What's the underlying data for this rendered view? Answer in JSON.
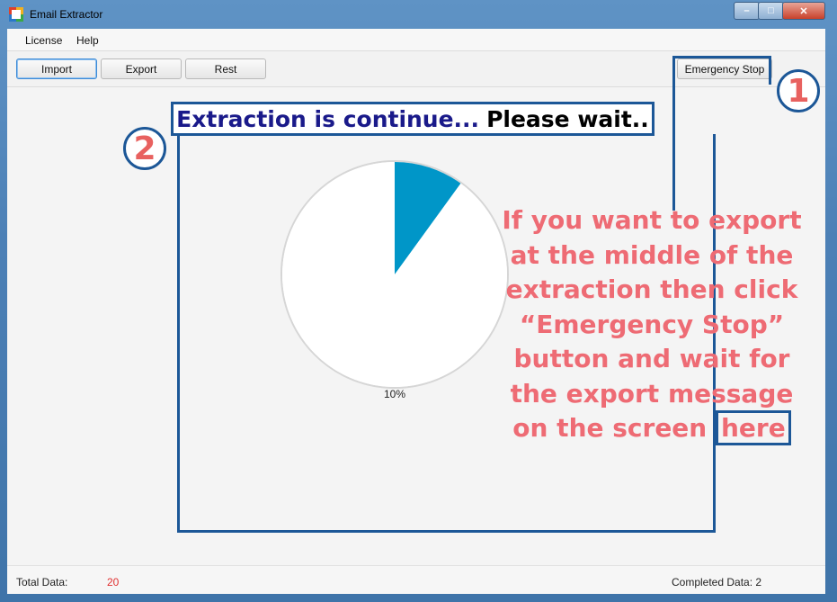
{
  "window": {
    "title": "Email Extractor",
    "minimize": "–",
    "maximize": "□",
    "close": "✕"
  },
  "menu": {
    "items": [
      "License",
      "Help"
    ]
  },
  "toolbar": {
    "import_label": "Import",
    "export_label": "Export",
    "rest_label": "Rest",
    "emergency_label": "Emergency Stop"
  },
  "chart_data": {
    "type": "pie",
    "values": [
      10,
      90
    ],
    "colors": [
      "#0096c8",
      "#ffffff"
    ],
    "label": "10%"
  },
  "status": {
    "total_label": "Total Data:",
    "total_value": "20",
    "completed_label": "Completed Data: 2"
  },
  "annotations": {
    "headline_part1": "Extraction is continue...",
    "headline_part2": "Please wait..",
    "marker1": "1",
    "marker2": "2",
    "note_lines": [
      "If you want to export",
      "at the middle of the",
      "extraction then click",
      "“Emergency Stop”",
      "button and wait for",
      "the export message"
    ],
    "note_last_prefix": "on the screen ",
    "note_last_highlight": "here"
  },
  "colors": {
    "accent": "#1c5797",
    "note": "#ee6b74",
    "pie_slice": "#0096c8",
    "total_value": "#e03030"
  }
}
